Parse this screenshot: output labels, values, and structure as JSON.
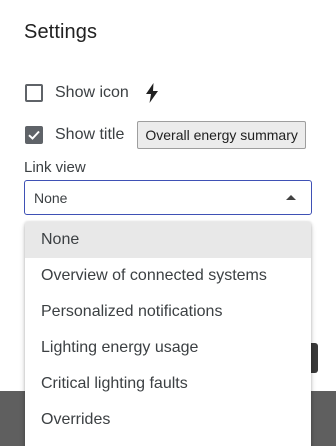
{
  "dialog": {
    "title": "Settings"
  },
  "options": {
    "show_icon": {
      "label": "Show icon",
      "checked": false,
      "icon": "bolt-icon"
    },
    "show_title": {
      "label": "Show title",
      "checked": true,
      "value": "Overall energy summary"
    }
  },
  "link_view": {
    "label": "Link view",
    "selected": "None",
    "options": [
      "None",
      "Overview of connected systems",
      "Personalized notifications",
      "Lighting energy usage",
      "Critical lighting faults",
      "Overrides"
    ]
  },
  "colors": {
    "accent": "#3f51b5",
    "checkbox": "#5f6368",
    "selected_item_bg": "#e8e8e8",
    "backdrop": "#5f5f5f"
  }
}
